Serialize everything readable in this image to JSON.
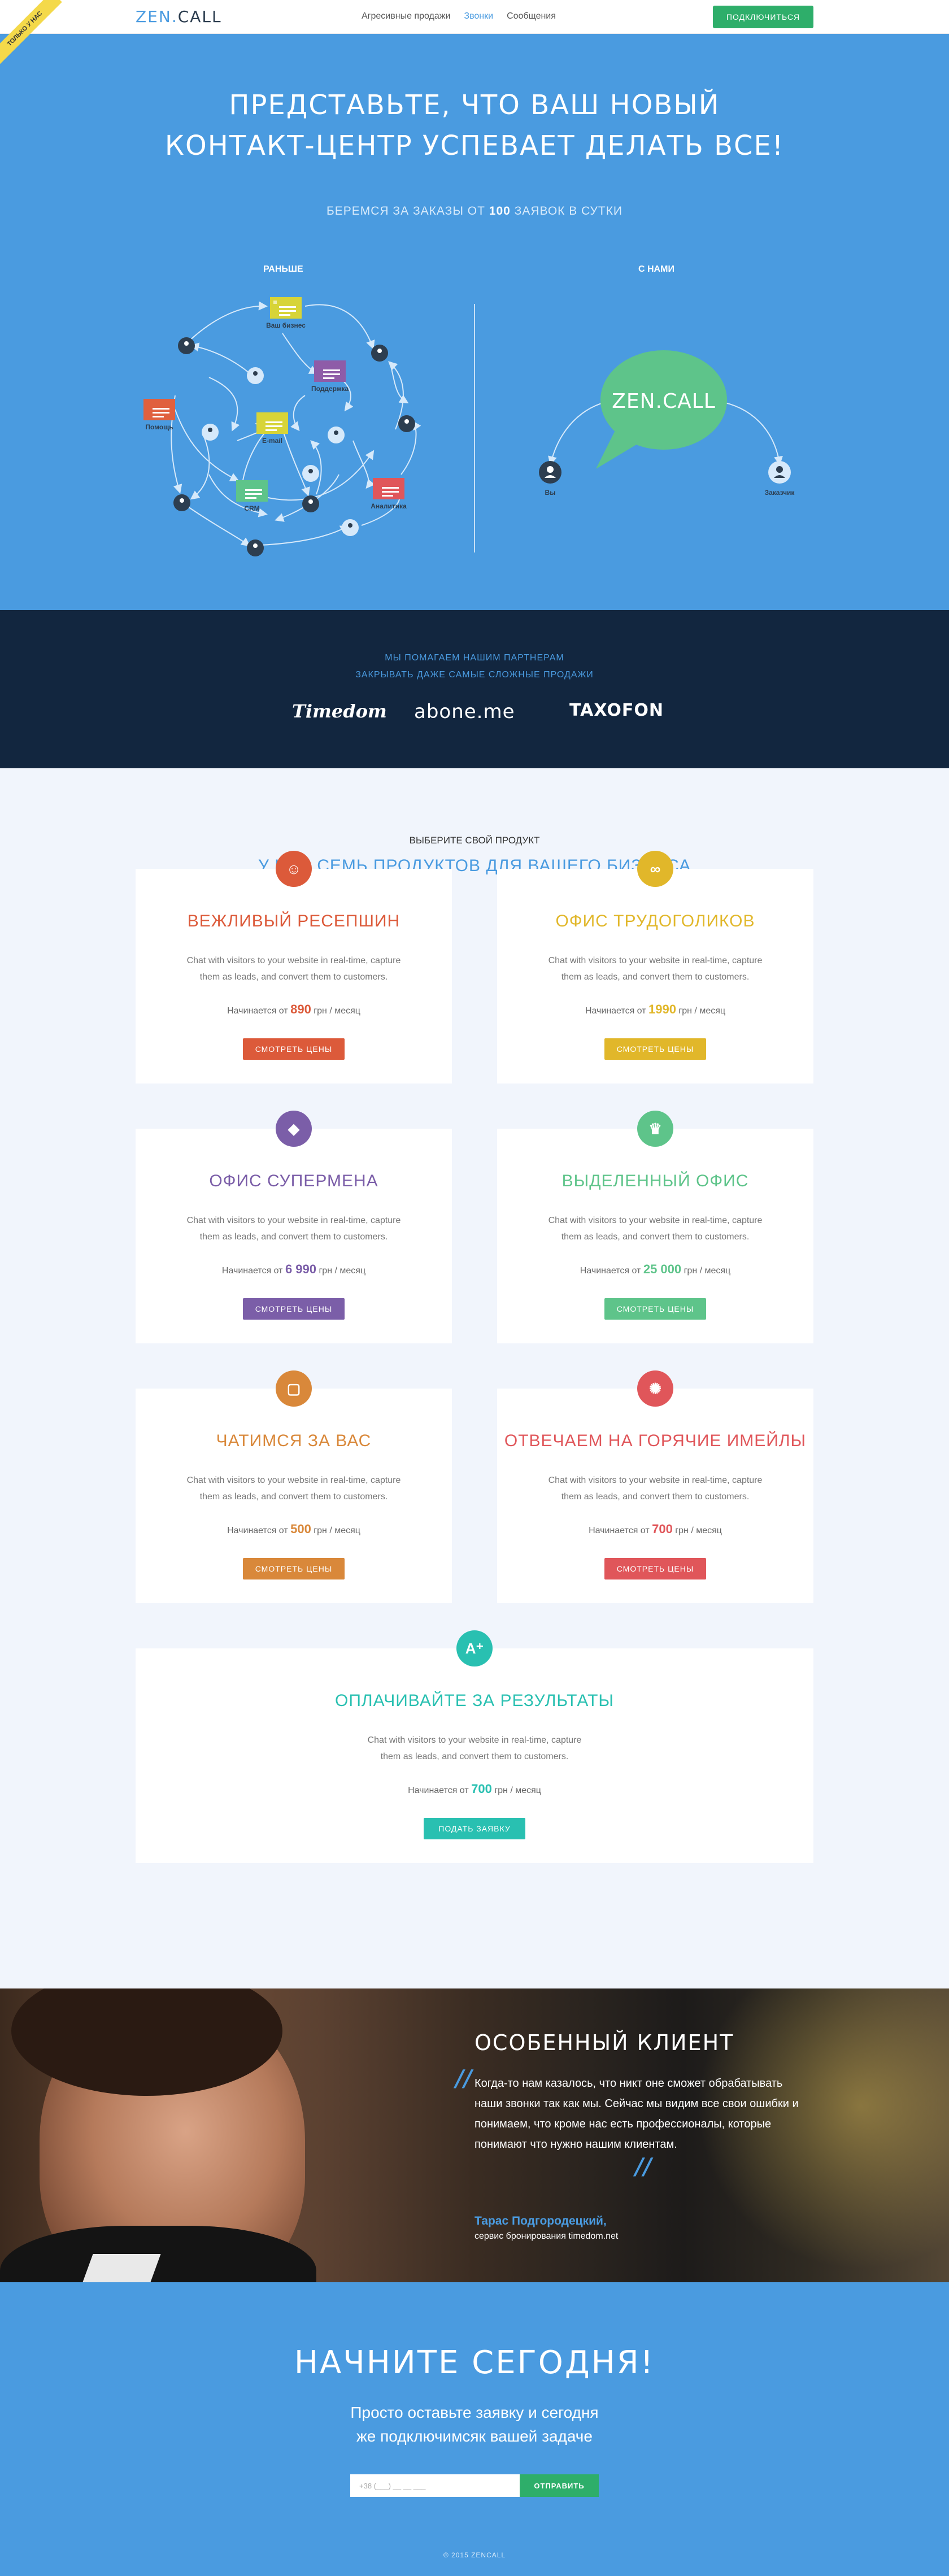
{
  "nav": {
    "logo_a": "ZEN.",
    "logo_b": "CALL",
    "items": [
      "Агресивные продажи",
      "Звонки",
      "Сообщения"
    ],
    "connect": "Подключиться",
    "ribbon": "Только у нас"
  },
  "hero": {
    "title_l1": "Представьте, что ваш новый",
    "title_l2": "контакт-центр успевает делать все!",
    "sub_a": "Беремся за заказы от",
    "sub_b": "100",
    "sub_c": "заявок в сутки",
    "before": "Раньше",
    "after": "С нами",
    "nodes": [
      "Ваш бизнес",
      "Поддержка",
      "Помощь",
      "E-mail",
      "CRM",
      "Аналитика"
    ],
    "bubble": "ZEN.CALL",
    "you": "Вы",
    "client": "Заказчик"
  },
  "partners": {
    "line1": "Мы помагаем нашим партнерам",
    "line2": "закрывать даже самые сложные продажи",
    "logos": [
      "Timedom",
      "abone.me",
      "TAXOFON"
    ]
  },
  "products": {
    "kicker": "Выберите свой продукт",
    "title": "У нас семь продуктов для вашего бизнеса",
    "desc_l1": "Chat with visitors to your website in real-time, capture",
    "desc_l2": "them as leads, and convert them to customers.",
    "from": "Начинается от",
    "per": "грн / месяц",
    "items": [
      {
        "name": "Вежливый ресепшин",
        "price": "890",
        "cta": "Смотреть цены",
        "color": "#dc5a3a"
      },
      {
        "name": "Офис трудоголиков",
        "price": "1990",
        "cta": "Смотреть цены",
        "color": "#e1b72a"
      },
      {
        "name": "Офис супермена",
        "price": "6 990",
        "cta": "Смотреть цены",
        "color": "#7b5ea8"
      },
      {
        "name": "Выделенный офис",
        "price": "25 000",
        "cta": "Смотреть цены",
        "color": "#5ec48a"
      },
      {
        "name": "Чатимся за вас",
        "price": "500",
        "cta": "Смотреть цены",
        "color": "#d9883a"
      },
      {
        "name": "Отвечаем на горячие имейлы",
        "price": "700",
        "cta": "Смотреть цены",
        "color": "#e0565a"
      },
      {
        "name": "Оплачивайте за результаты",
        "price": "700",
        "cta": "Подать заявку",
        "color": "#29c0b1"
      }
    ]
  },
  "testimonial": {
    "title": "Особенный клиент",
    "quote": "Когда-то нам казалось, что никт оне сможет обрабатывать наши звонки так как мы. Сейчас мы видим все свои ошибки и понимаем, что кроме нас есть профессионалы, которые понимают что нужно нашим клиентам.",
    "author": "Тарас Подгородецкий,",
    "author_sub": "сервис бронирования timedom.net"
  },
  "cta": {
    "title": "Начните сегодня!",
    "line1": "Просто оставьте заявку и сегодня",
    "line2": "же подключимсяк вашей задаче",
    "phone_placeholder": "+38 (___) __ __ ___",
    "send": "Отправить",
    "copyright": "© 2015 ZENCALL"
  }
}
